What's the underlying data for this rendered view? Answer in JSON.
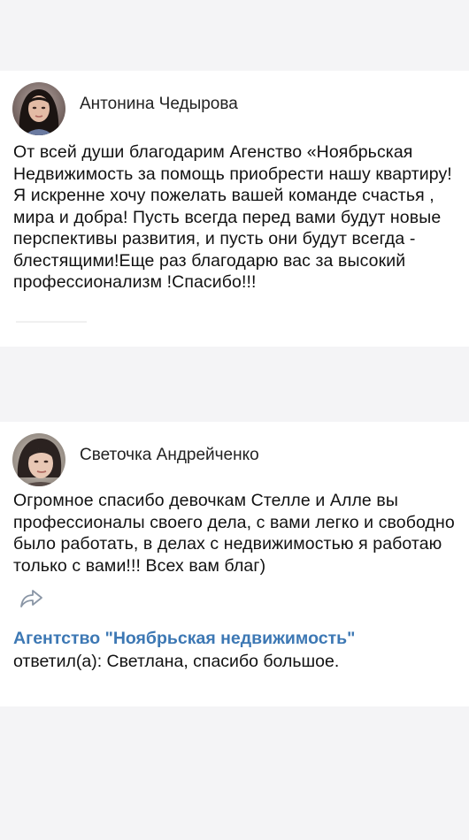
{
  "reviews": [
    {
      "author": "Антонина Чедырова",
      "avatar_icon": "user-avatar-icon",
      "text": "От всей души благодарим Агенство «Ноябрьская Недвижимость за помощь приобрести нашу квартиру! Я искренне хочу пожелать вашей команде счастья , мира и добра! Пусть всегда перед вами будут новые перспективы развития, и пусть они будут всегда - блестящими!Еще раз благодарю вас за высокий профессионализм !Спасибо!!!"
    },
    {
      "author": "Светочка Андрейченко",
      "avatar_icon": "user-avatar-icon",
      "text": "Огромное спасибо девочкам Стелле и Алле вы профессионалы своего дела, с вами легко и свободно было работать, в делах с недвижимостью я работаю только с вами!!! Всех вам благ)",
      "share_icon": "share-arrow-icon",
      "reply": {
        "agency": "Агентство \"Ноябрьская недвижимость\"",
        "text": " ответил(а): Светлана, спасибо большое."
      }
    }
  ],
  "colors": {
    "background": "#f4f4f6",
    "card": "#ffffff",
    "link": "#3d78b4",
    "text": "#111111"
  }
}
